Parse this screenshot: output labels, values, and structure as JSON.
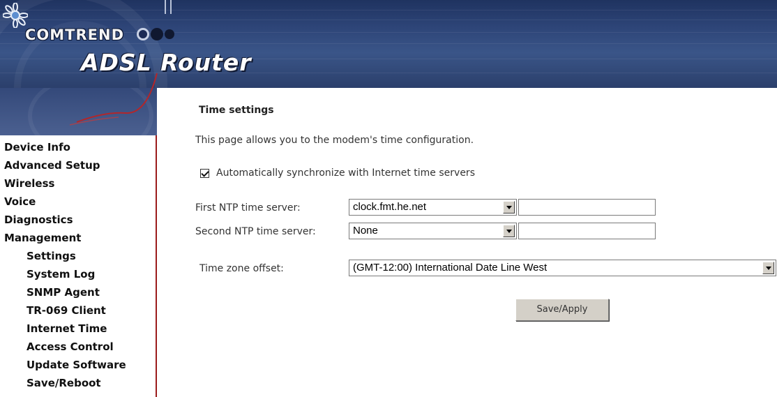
{
  "header": {
    "brand": "COMTREND",
    "product": "ADSL Router"
  },
  "sidebar": {
    "items": [
      {
        "label": "Device Info"
      },
      {
        "label": "Advanced Setup"
      },
      {
        "label": "Wireless"
      },
      {
        "label": "Voice"
      },
      {
        "label": "Diagnostics"
      },
      {
        "label": "Management"
      }
    ],
    "subitems": [
      {
        "label": "Settings"
      },
      {
        "label": "System Log"
      },
      {
        "label": "SNMP Agent"
      },
      {
        "label": "TR-069 Client"
      },
      {
        "label": "Internet Time"
      },
      {
        "label": "Access Control"
      },
      {
        "label": "Update Software"
      },
      {
        "label": "Save/Reboot"
      }
    ]
  },
  "main": {
    "title": "Time settings",
    "description": "This page allows you to the modem's time configuration.",
    "auto_sync": {
      "checked": true,
      "label": "Automatically synchronize with Internet time servers"
    },
    "first_ntp": {
      "label": "First NTP time server:",
      "selected": "clock.fmt.he.net",
      "other": ""
    },
    "second_ntp": {
      "label": "Second NTP time server:",
      "selected": "None",
      "other": ""
    },
    "timezone": {
      "label": "Time zone offset:",
      "selected": "(GMT-12:00) International Date Line West"
    },
    "save_label": "Save/Apply"
  },
  "colors": {
    "banner": "#2d4477",
    "sidebar_border": "#9b1b1b",
    "button_face": "#d4d0c8"
  }
}
